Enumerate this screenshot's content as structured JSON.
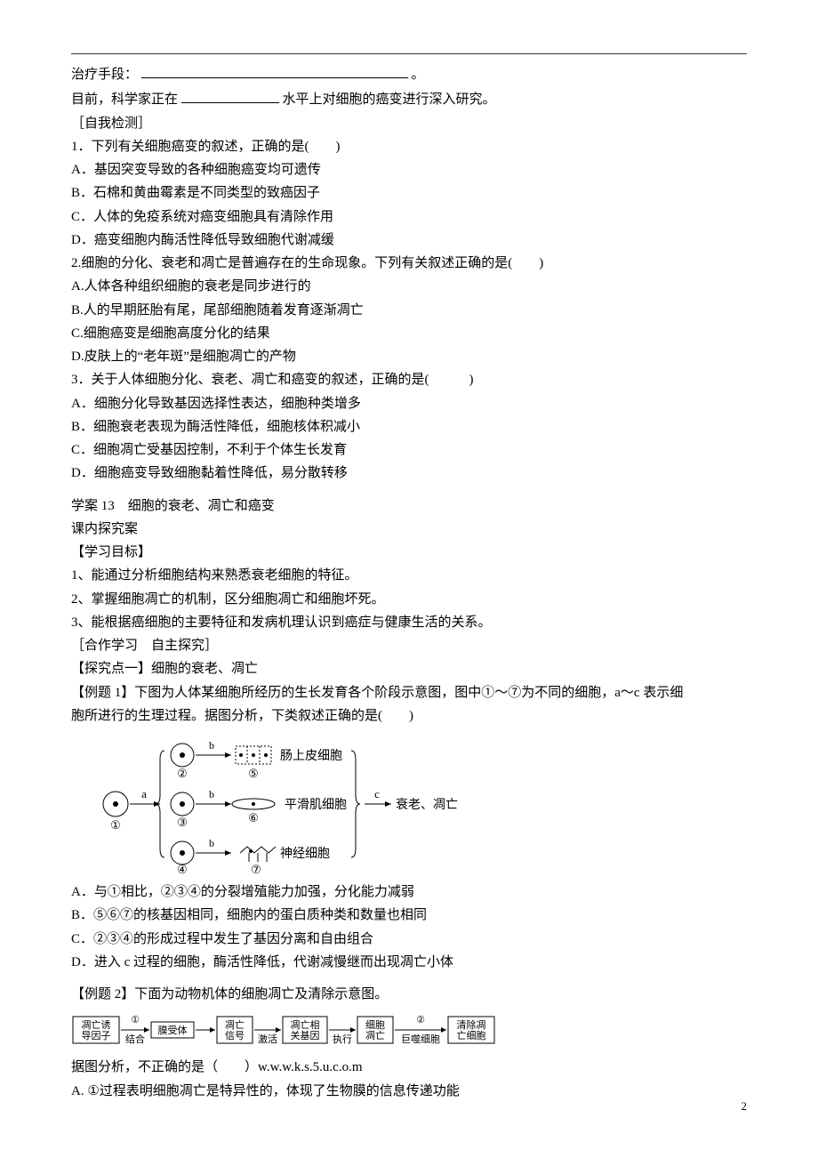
{
  "top": {
    "line1a": "治疗手段：",
    "line1b": "。",
    "line2a": "目前，科学家正在",
    "line2b": "水平上对细胞的癌变进行深入研究。"
  },
  "selftest": {
    "heading": "［自我检测］",
    "q1": {
      "stem": "1．下列有关细胞癌变的叙述，正确的是(　　)",
      "A": "A．基因突变导致的各种细胞癌变均可遗传",
      "B": "B．石棉和黄曲霉素是不同类型的致癌因子",
      "C": "C．人体的免疫系统对癌变细胞具有清除作用",
      "D": "D．癌变细胞内酶活性降低导致细胞代谢减缓"
    },
    "q2": {
      "stem": "2.细胞的分化、衰老和凋亡是普遍存在的生命现象。下列有关叙述正确的是(　　)",
      "A": "A.人体各种组织细胞的衰老是同步进行的",
      "B": "B.人的早期胚胎有尾，尾部细胞随着发育逐渐凋亡",
      "C": "C.细胞癌变是细胞高度分化的结果",
      "D": "D.皮肤上的“老年斑”是细胞凋亡的产物"
    },
    "q3": {
      "stem": "3．关于人体细胞分化、衰老、凋亡和癌变的叙述，正确的是(　　　)",
      "A": "A．细胞分化导致基因选择性表达，细胞种类增多",
      "B": "B．细胞衰老表现为酶活性降低，细胞核体积减小",
      "C": "C．细胞凋亡受基因控制，不利于个体生长发育",
      "D": "D．细胞癌变导致细胞黏着性降低，易分散转移"
    }
  },
  "xuean": {
    "title": "学案 13　细胞的衰老、凋亡和癌变",
    "sub": "课内探究案",
    "objHead": "【学习目标】",
    "obj1": "1、能通过分析细胞结构来熟悉衰老细胞的特征。",
    "obj2": "2、掌握细胞凋亡的机制，区分细胞凋亡和细胞坏死。",
    "obj3": "3、能根据癌细胞的主要特征和发病机理认识到癌症与健康生活的关系。",
    "coop": "［合作学习　自主探究］",
    "t1head": "【探究点一】细胞的衰老、凋亡",
    "ex1stem1": "【例题 1】下图为人体某细胞所经历的生长发育各个阶段示意图，图中①～⑦为不同的细胞，a～c 表示细",
    "ex1stem2": "胞所进行的生理过程。据图分析，下类叙述正确的是(　　)",
    "diagram1": {
      "labels": {
        "cell1": "①",
        "cell2": "②",
        "cell3": "③",
        "cell4": "④",
        "cell5": "⑤",
        "cell6": "⑥",
        "cell7": "⑦",
        "a": "a",
        "b": "b",
        "c": "c",
        "epi": "肠上皮细胞",
        "muscle": "平滑肌细胞",
        "nerve": "神经细胞",
        "aging": "衰老、凋亡"
      }
    },
    "ex1": {
      "A": "A．与①相比，②③④的分裂增殖能力加强，分化能力减弱",
      "B": "B．⑤⑥⑦的核基因相同，细胞内的蛋白质种类和数量也相同",
      "C": "C．②③④的形成过程中发生了基因分离和自由组合",
      "D": "D．进入 c 过程的细胞，酶活性降低，代谢减慢继而出现凋亡小体"
    },
    "ex2stem": "【例题 2】下面为动物机体的细胞凋亡及清除示意图。",
    "diagram2": {
      "b1": "凋亡诱\n导因子",
      "a1": "①",
      "s1": "结合",
      "b2": "膜受体",
      "b3": "凋亡\n信号",
      "s2": "激活",
      "b4": "凋亡相\n关基因",
      "s3": "执行",
      "b5": "细胞\n凋亡",
      "a2": "②",
      "s4": "巨噬细胞",
      "b6": "清除凋\n亡细胞"
    },
    "ex2after": "据图分析，不正确的是（　　）w.w.w.k.s.5.u.c.o.m",
    "ex2A": "A. ①过程表明细胞凋亡是特异性的，体现了生物膜的信息传递功能"
  },
  "pageNumber": "2"
}
